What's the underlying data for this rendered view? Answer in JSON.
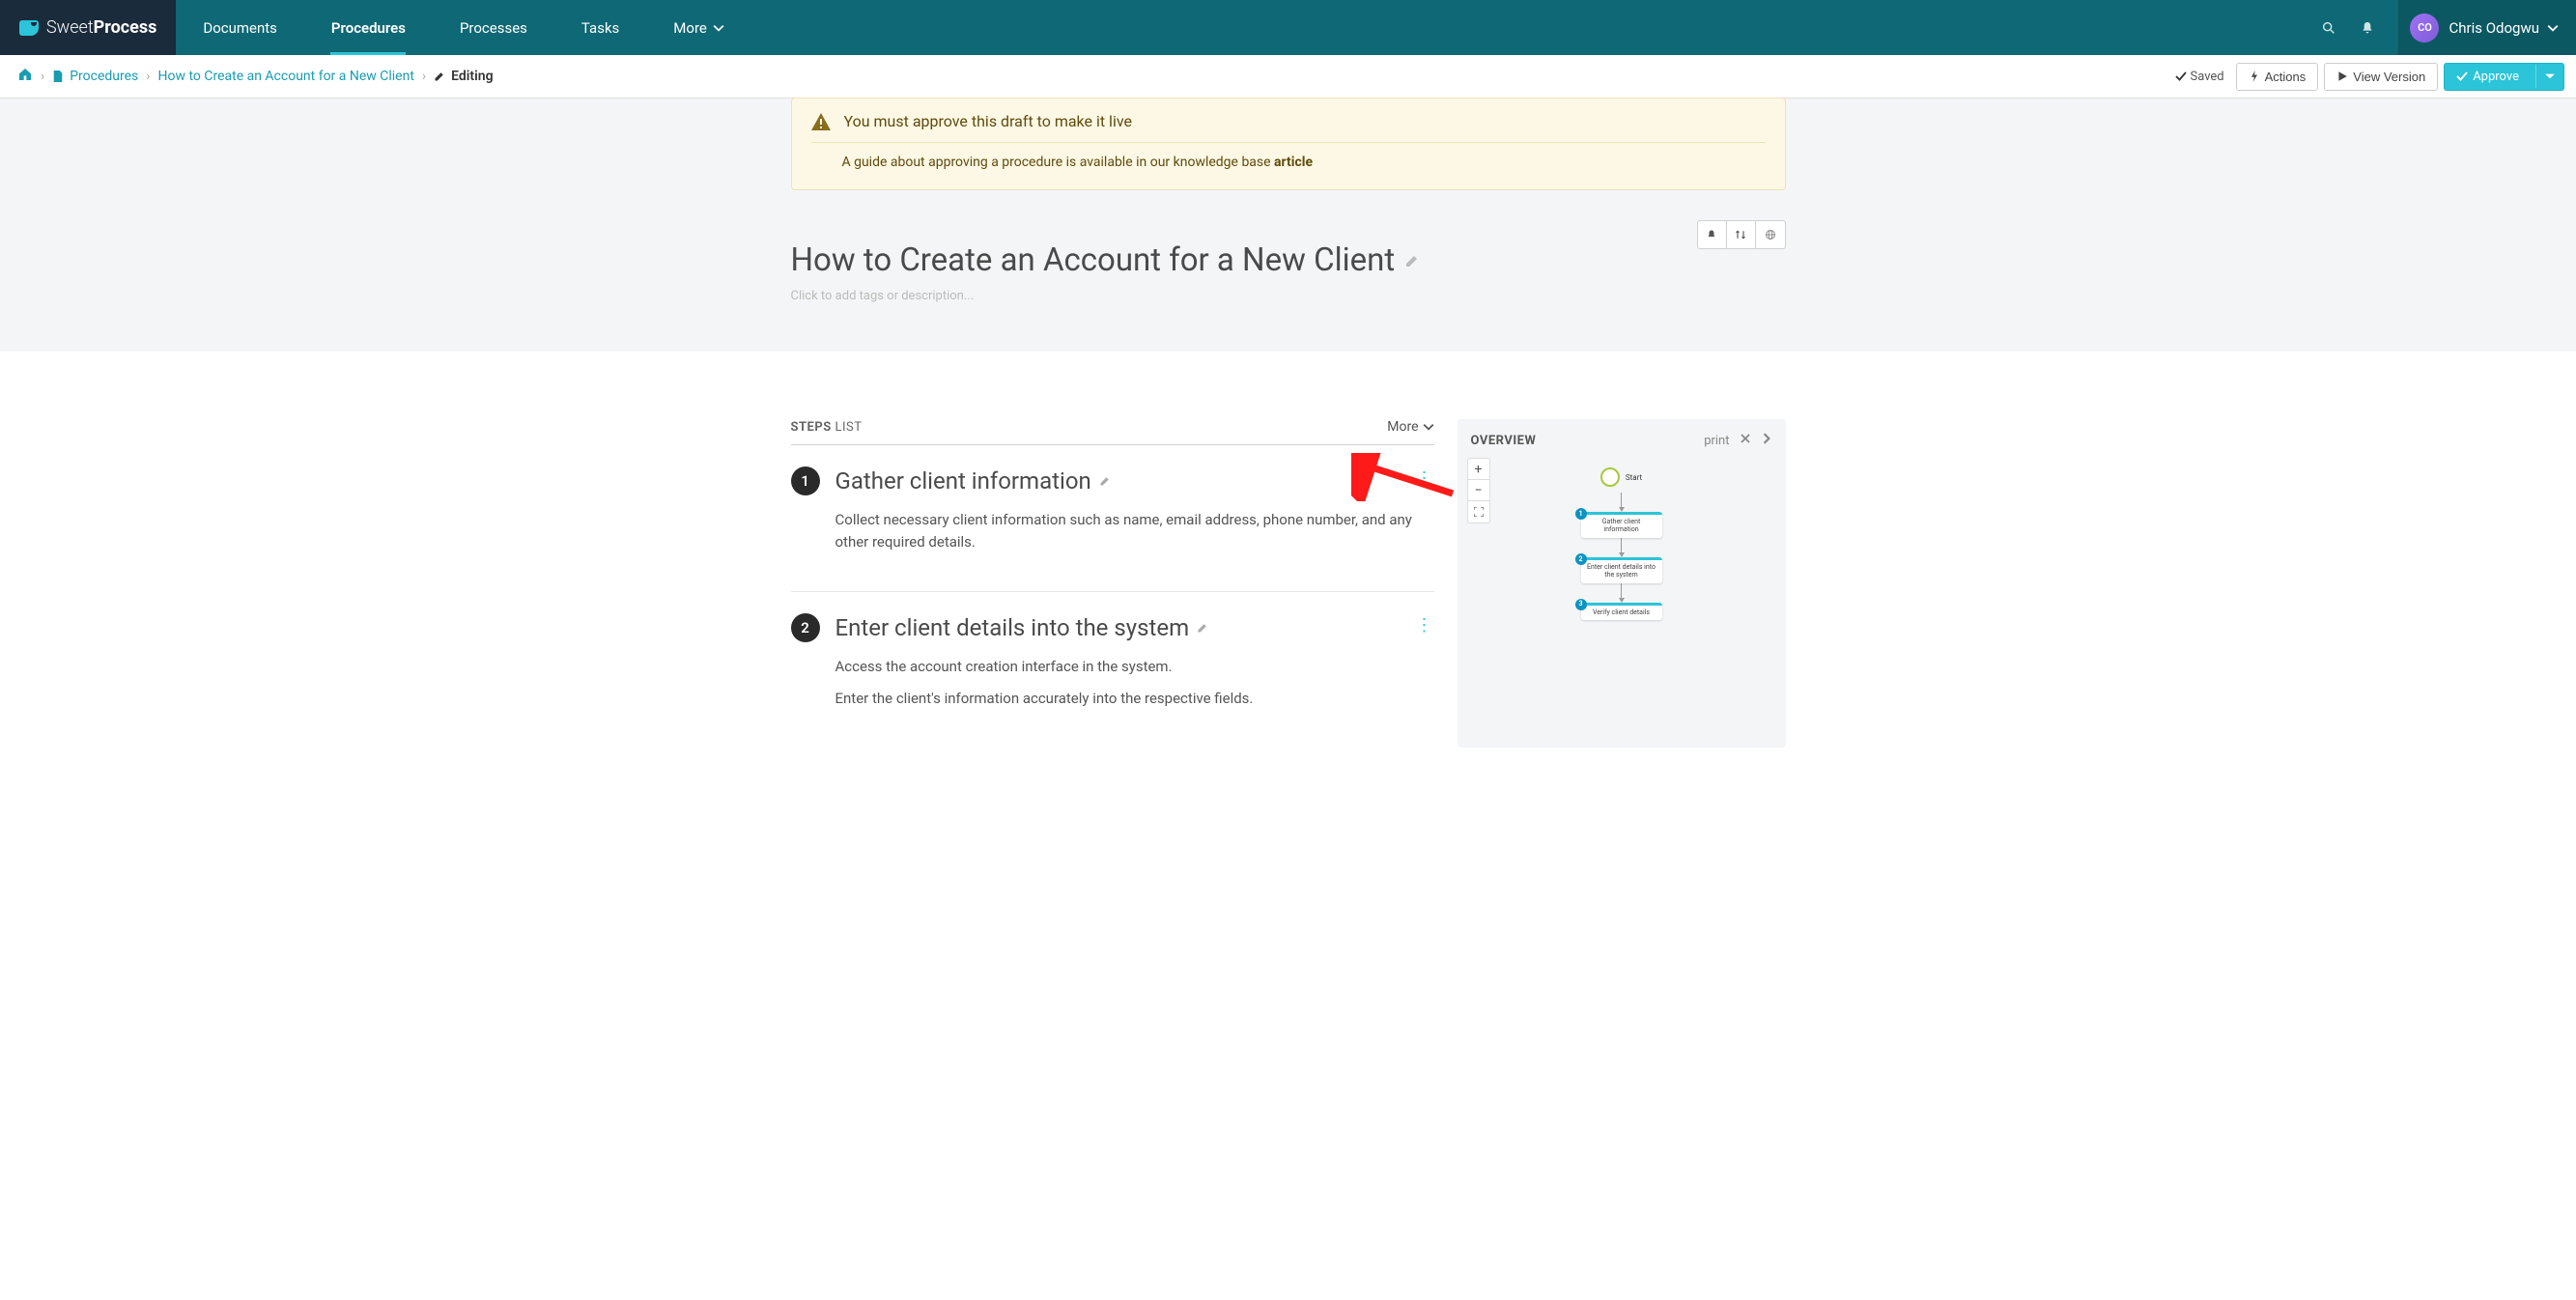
{
  "brand": {
    "light": "Sweet",
    "bold": "Process"
  },
  "nav": {
    "items": [
      {
        "label": "Documents"
      },
      {
        "label": "Procedures"
      },
      {
        "label": "Processes"
      },
      {
        "label": "Tasks"
      },
      {
        "label": "More"
      }
    ],
    "active_index": 1
  },
  "user": {
    "initials": "CO",
    "name": "Chris Odogwu"
  },
  "breadcrumb": {
    "procedures": "Procedures",
    "title": "How to Create an Account for a New Client",
    "editing": "Editing"
  },
  "subbar": {
    "saved": "Saved",
    "actions": "Actions",
    "view_version": "View Version",
    "approve": "Approve"
  },
  "banner": {
    "title": "You must approve this draft to make it live",
    "sub_prefix": "A guide about approving a procedure is available in our knowledge base ",
    "sub_link": "article"
  },
  "procedure": {
    "title": "How to Create an Account for a New Client",
    "tags_placeholder": "Click to add tags or description..."
  },
  "steps_list": {
    "heading_bold": "STEPS",
    "heading_light": "LIST",
    "more": "More"
  },
  "steps": [
    {
      "num": "1",
      "title": "Gather client information",
      "desc": [
        "Collect necessary client information such as name, email address, phone number, and any other required details."
      ]
    },
    {
      "num": "2",
      "title": "Enter client details into the system",
      "desc": [
        "Access the account creation interface in the system.",
        "Enter the client's information accurately into the respective fields."
      ]
    }
  ],
  "overview": {
    "title": "OVERVIEW",
    "print": "print",
    "start": "Start",
    "nodes": [
      {
        "num": "1",
        "label": "Gather client information"
      },
      {
        "num": "2",
        "label": "Enter client details into the system"
      },
      {
        "num": "3",
        "label": "Verify client details"
      }
    ]
  }
}
